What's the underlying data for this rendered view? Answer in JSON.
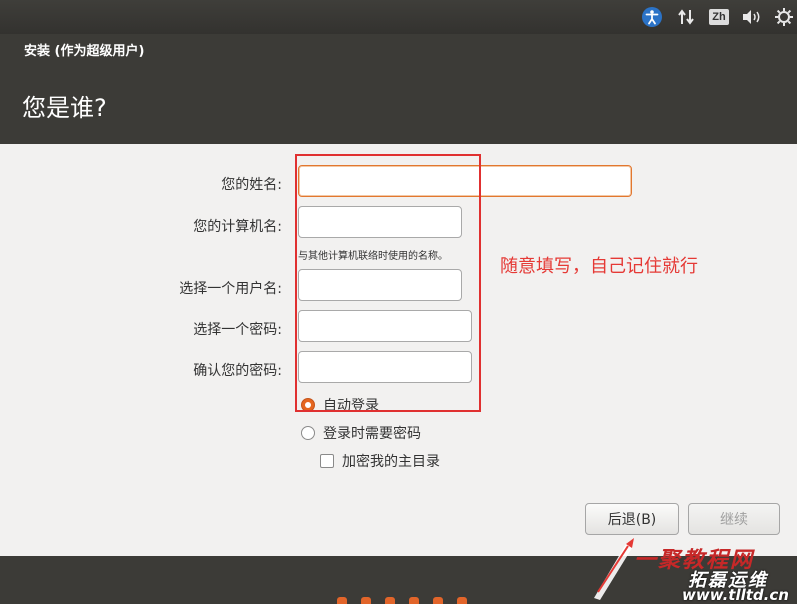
{
  "topbar": {
    "icons": [
      "accessibility-icon",
      "network-icon",
      "keyboard-layout-icon",
      "volume-icon",
      "power-gear-icon"
    ],
    "keyboard_layout_label": "Zh"
  },
  "header": {
    "window_title": "安装 (作为超级用户)",
    "page_title": "您是谁?"
  },
  "form": {
    "name_label": "您的姓名:",
    "computer_name_label": "您的计算机名:",
    "computer_name_hint": "与其他计算机联络时使用的名称。",
    "username_label": "选择一个用户名:",
    "password_label": "选择一个密码:",
    "confirm_password_label": "确认您的密码:",
    "name_value": "",
    "computer_name_value": "",
    "username_value": "",
    "password_value": "",
    "confirm_password_value": ""
  },
  "login_options": {
    "auto_login_label": "自动登录",
    "require_password_label": "登录时需要密码",
    "encrypt_home_label": "加密我的主目录",
    "selected": "auto_login",
    "encrypt_home_checked": false
  },
  "annotation": {
    "note": "随意填写，自己记住就行",
    "color": "#e53935"
  },
  "buttons": {
    "back_label": "后退(B)",
    "continue_label": "继续"
  },
  "watermark": {
    "brand": "一聚教程网",
    "subtitle": "拓磊运维",
    "url": "www.tlltd.cn"
  },
  "colors": {
    "accent": "#e2772f",
    "header_bg": "#3c3b37",
    "content_bg": "#f2f1f0"
  }
}
